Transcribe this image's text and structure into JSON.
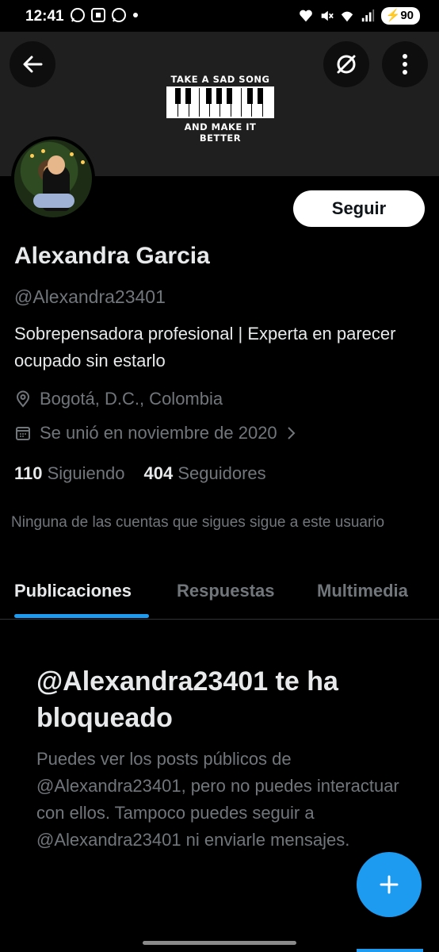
{
  "status_bar": {
    "time": "12:41",
    "battery": "90"
  },
  "banner": {
    "line1": "TAKE A SAD SONG",
    "line2": "AND MAKE IT BETTER"
  },
  "profile": {
    "follow_label": "Seguir",
    "name": "Alexandra Garcia",
    "handle": "@Alexandra23401",
    "bio": "Sobrepensadora profesional | Experta en parecer ocupado sin estarlo",
    "location": "Bogotá, D.C., Colombia",
    "joined": "Se unió en noviembre de 2020",
    "following_count": "110",
    "following_label": "Siguiendo",
    "followers_count": "404",
    "followers_label": "Seguidores",
    "mutuals_notice": "Ninguna de las cuentas que sigues sigue a este usuario"
  },
  "tabs": [
    {
      "label": "Publicaciones",
      "active": true
    },
    {
      "label": "Respuestas",
      "active": false
    },
    {
      "label": "Multimedia",
      "active": false
    }
  ],
  "blocked": {
    "title": "@Alexandra23401 te ha bloqueado",
    "text": "Puedes ver los posts públicos de @Alexandra23401, pero no puedes interactuar con ellos. Tampoco puedes seguir a @Alexandra23401 ni enviarle mensajes."
  },
  "colors": {
    "accent": "#1d9bf0",
    "background": "#000000",
    "muted": "#71767b"
  },
  "icons": [
    "back-arrow-icon",
    "grok-icon",
    "more-vertical-icon",
    "location-pin-icon",
    "calendar-icon",
    "chevron-right-icon",
    "plus-icon"
  ]
}
